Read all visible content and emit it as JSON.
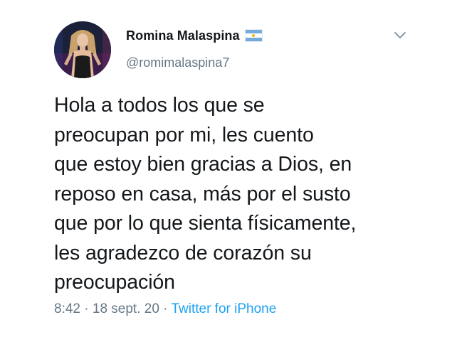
{
  "author": {
    "display_name": "Romina Malaspina",
    "handle": "@romimalaspina7",
    "flag_icon": "argentina-flag-icon",
    "avatar_icon": "profile-photo"
  },
  "menu": {
    "icon": "chevron-down-icon"
  },
  "tweet": {
    "text": "Hola a todos los que se\npreocupan por mi, les cuento\nque estoy bien gracias a Dios, en\nreposo en casa, más por el susto\nque por lo que sienta físicamente,\nles agradezco de corazón su\npreocupación",
    "time": "8:42",
    "separator1": " · ",
    "date": "18 sept. 20",
    "separator2": " · ",
    "source": "Twitter for iPhone"
  },
  "colors": {
    "text": "#14171a",
    "secondary": "#657786",
    "link": "#1da1f2",
    "flag_blue": "#75aadb",
    "flag_sun": "#f6b40e"
  }
}
